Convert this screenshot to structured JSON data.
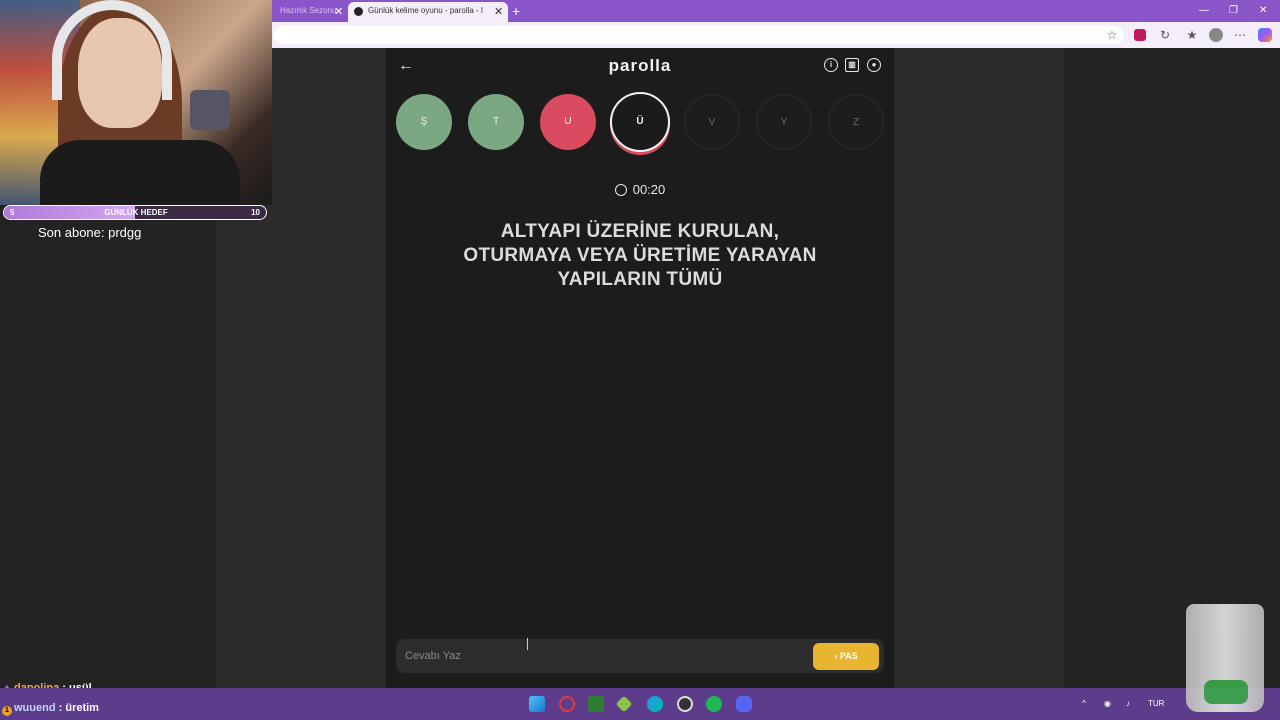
{
  "browser": {
    "tabs": [
      {
        "label": "Hazırlık Sezonu",
        "active": false
      },
      {
        "label": "Günlük kelime oyunu - parolla - l",
        "active": true
      }
    ],
    "new_tab_icon": "plus-icon",
    "window_controls": [
      "minimize-icon",
      "restore-icon",
      "close-icon"
    ],
    "colors": {
      "frame": "#8a55c8",
      "toolbar": "#f3eefa"
    }
  },
  "stream": {
    "goal": {
      "label": "GÜNLÜK HEDEF",
      "current": "5",
      "target": "10",
      "progress": 0.5
    },
    "last_sub_label": "Son abone: prdgg",
    "chat": [
      {
        "user": "dapolipa",
        "sep": " : ",
        "message": "usül"
      },
      {
        "user": "wuuend",
        "sep": " : ",
        "message": "üretim"
      }
    ]
  },
  "game": {
    "title": "parolla",
    "icons": [
      "info-icon",
      "stats-icon",
      "profile-icon"
    ],
    "letters": [
      {
        "letter": "Ş",
        "state": "correct"
      },
      {
        "letter": "T",
        "state": "correct"
      },
      {
        "letter": "U",
        "state": "wrong"
      },
      {
        "letter": "Ü",
        "state": "current"
      },
      {
        "letter": "V",
        "state": "pending"
      },
      {
        "letter": "Y",
        "state": "pending"
      },
      {
        "letter": "Z",
        "state": "pending"
      }
    ],
    "timer": "00:20",
    "question": "ALTYAPI ÜZERİNE KURULAN, OTURMAYA VEYA ÜRETİME YARAYAN YAPILARIN TÜMÜ",
    "answer_placeholder": "Cevabı Yaz",
    "pass_label": "PAS",
    "colors": {
      "correct": "#7ba882",
      "wrong": "#d94a5e",
      "pass": "#e7b52f"
    }
  },
  "taskbar": {
    "apps": [
      "windows-icon",
      "opera-icon",
      "terminal-icon",
      "vpn-icon",
      "edge-icon",
      "obs-icon",
      "spotify-icon",
      "discord-icon"
    ],
    "tray_lang": "TUR"
  }
}
